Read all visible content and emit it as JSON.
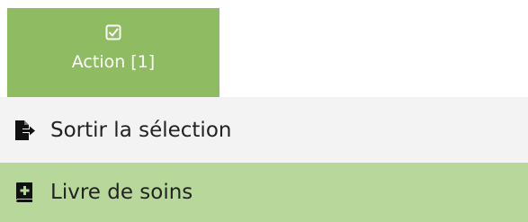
{
  "action_button": {
    "label": "Action [1]",
    "icon": "checkbox-checked-icon",
    "bg_color": "#8fbc62",
    "text_color": "#ffffff"
  },
  "menu": {
    "items": [
      {
        "label": "Sortir la sélection",
        "icon": "file-export-icon",
        "bg_color": "#f3f3f3"
      },
      {
        "label": "Livre de soins",
        "icon": "book-plus-icon",
        "bg_color": "#b7d89a"
      }
    ]
  }
}
